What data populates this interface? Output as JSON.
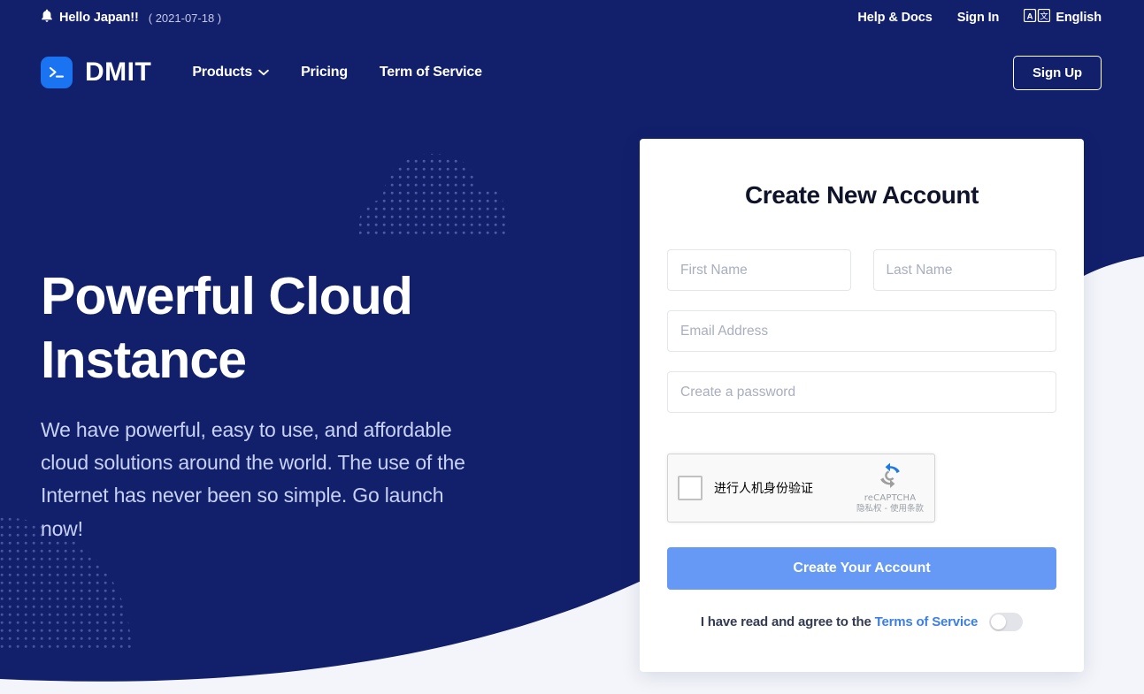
{
  "colors": {
    "navy": "#121f6b",
    "page_bg": "#f4f5fa",
    "accent_blue": "#6699f5",
    "logo_blue": "#1a73f0",
    "link_blue": "#3d7fe0"
  },
  "topbar": {
    "bell_icon": "bell-icon",
    "announcement": "Hello Japan!!",
    "date": "( 2021-07-18 )",
    "links": [
      {
        "label": "Help & Docs"
      },
      {
        "label": "Sign In"
      }
    ],
    "language": {
      "icon": "translate-icon",
      "label": "English"
    }
  },
  "nav": {
    "logo_icon": "terminal-prompt-icon",
    "brand": "DMIT",
    "links": [
      {
        "label": "Products",
        "has_dropdown": true,
        "icon": "chevron-down-icon"
      },
      {
        "label": "Pricing",
        "has_dropdown": false
      },
      {
        "label": "Term of Service",
        "has_dropdown": false
      }
    ],
    "signup_label": "Sign Up"
  },
  "hero": {
    "title": "Powerful Cloud Instance",
    "subtitle": "We have powerful, easy to use, and affordable cloud solutions around the world. The use of the Internet has never been so simple. Go launch now!"
  },
  "signup_form": {
    "title": "Create New Account",
    "fields": {
      "first_name_placeholder": "First Name",
      "first_name_value": "",
      "last_name_placeholder": "Last Name",
      "last_name_value": "",
      "email_placeholder": "Email Address",
      "email_value": "",
      "password_placeholder": "Create a password",
      "password_value": ""
    },
    "recaptcha": {
      "label": "进行人机身份验证",
      "brand": "reCAPTCHA",
      "terms": "隐私权 - 使用条款",
      "logo_icon": "recaptcha-logo-icon",
      "checked": false
    },
    "submit_label": "Create Your Account",
    "terms": {
      "text": "I have read and agree to the",
      "link_label": "Terms of Service",
      "toggle_on": false
    }
  }
}
